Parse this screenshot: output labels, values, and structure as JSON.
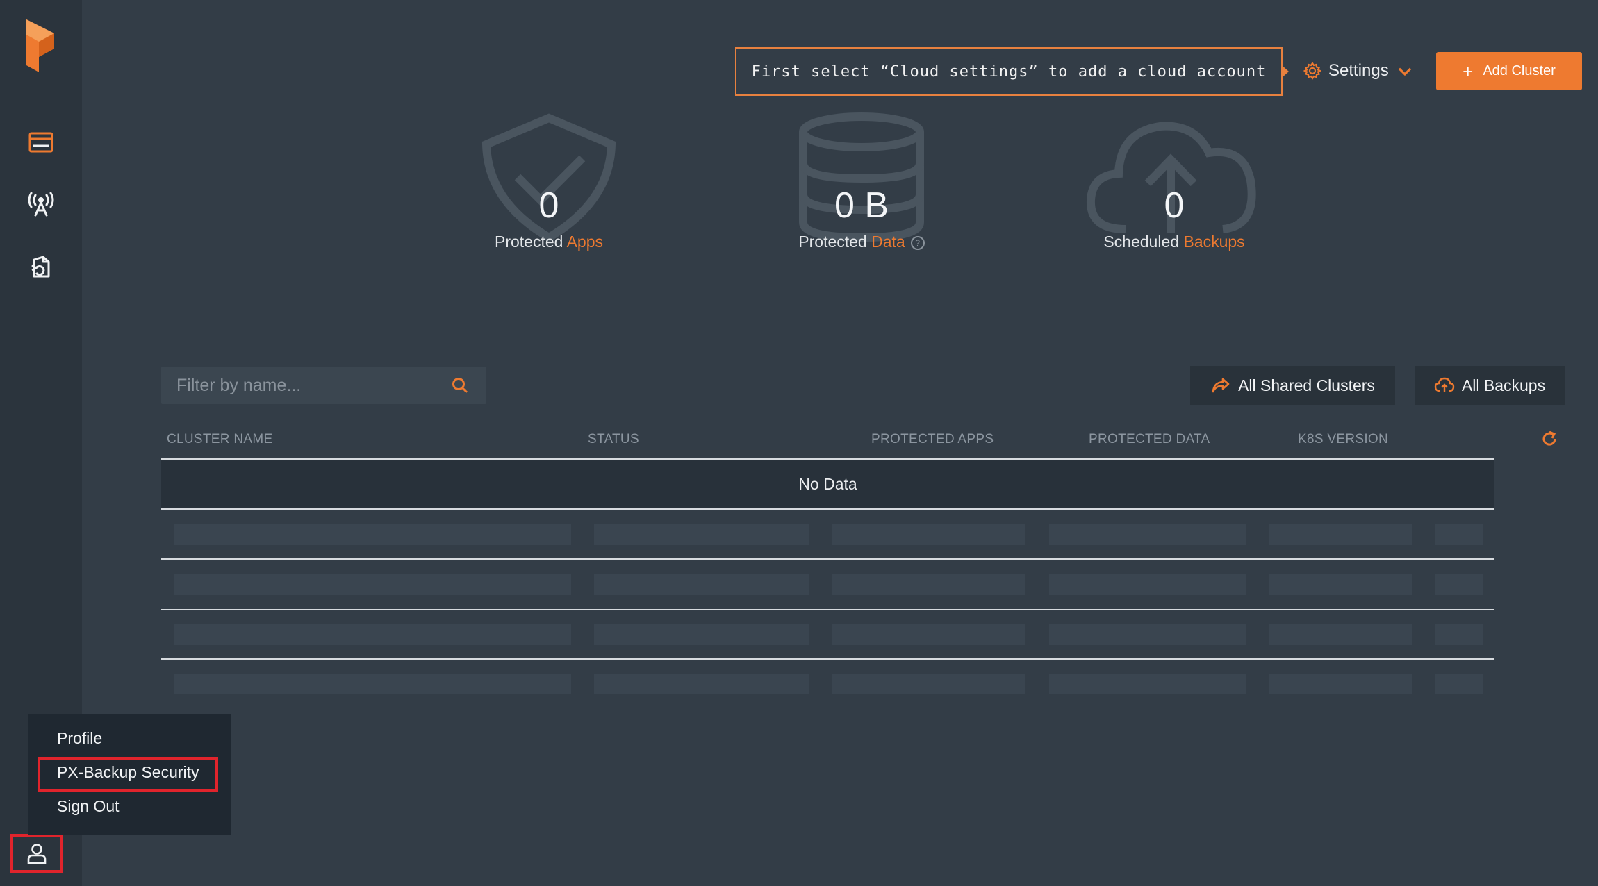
{
  "colors": {
    "background": "#333d47",
    "sidebar": "#2b343d",
    "accent": "#ee7a30",
    "highlight_box": "#e0242c"
  },
  "sidebar": {
    "logo": "portworx-logo-icon",
    "items": [
      {
        "icon": "browser-window-icon"
      },
      {
        "icon": "broadcast-antenna-icon"
      },
      {
        "icon": "document-refresh-icon"
      }
    ],
    "user_icon": "user-icon"
  },
  "user_menu": {
    "items": [
      "Profile",
      "PX-Backup Security",
      "Sign Out"
    ]
  },
  "header": {
    "notice": "First select “Cloud settings” to add a cloud account",
    "settings_label": "Settings",
    "add_cluster_label": "Add Cluster"
  },
  "stats": [
    {
      "value": "0",
      "label_prefix": "Protected",
      "label_accent": "Apps",
      "icon": "shield-check-icon"
    },
    {
      "value": "0 B",
      "label_prefix": "Protected",
      "label_accent": "Data",
      "icon": "database-icon"
    },
    {
      "value": "0",
      "label_prefix": "Scheduled",
      "label_accent": "Backups",
      "icon": "cloud-upload-icon"
    }
  ],
  "filter": {
    "placeholder": "Filter by name..."
  },
  "buttons": {
    "shared_clusters": "All Shared Clusters",
    "all_backups": "All Backups"
  },
  "table": {
    "columns": [
      "CLUSTER NAME",
      "STATUS",
      "PROTECTED APPS",
      "PROTECTED DATA",
      "K8S VERSION"
    ],
    "empty_text": "No Data"
  }
}
